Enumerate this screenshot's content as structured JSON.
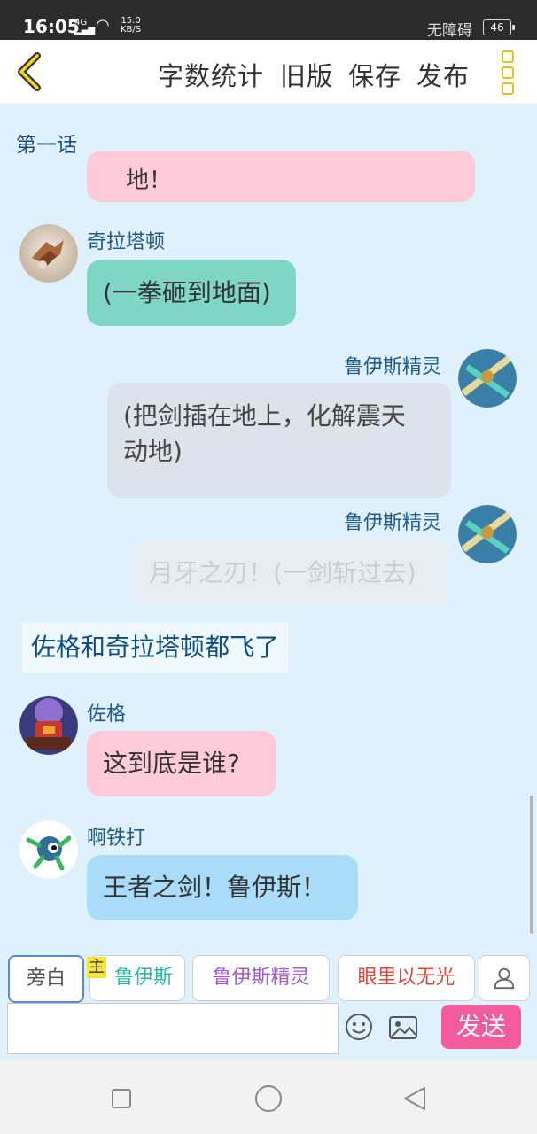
{
  "status_bar": {
    "time": "16:05",
    "net_label": "4G",
    "wifi_speed": "15.0",
    "speed_unit": "KB/S",
    "accessibility": "无障碍",
    "battery": "46"
  },
  "top_bar": {
    "menu": [
      "字数统计",
      "旧版",
      "保存",
      "发布"
    ]
  },
  "chapter_title": "第一话",
  "messages": [
    {
      "speaker": "",
      "text": "地！",
      "partial": true
    },
    {
      "speaker": "奇拉塔顿",
      "text": "(一拳砸到地面)"
    },
    {
      "speaker": "鲁伊斯精灵",
      "text": "(把剑插在地上，化解震天动地)",
      "lines": [
        "(把剑插在地上，化解震天",
        "动地)"
      ]
    },
    {
      "speaker": "鲁伊斯精灵",
      "text": "月牙之刃！(一剑斩过去)",
      "faded": true
    },
    {
      "narration": "佐格和奇拉塔顿都飞了"
    },
    {
      "speaker": "佐格",
      "text": "这到底是谁?"
    },
    {
      "speaker": "啊铁打",
      "text": "王者之剑！鲁伊斯！"
    }
  ],
  "roles": [
    {
      "label": "旁白",
      "color": "#555555"
    },
    {
      "label": "鲁伊斯",
      "color": "#2bb7a3",
      "tag": "主"
    },
    {
      "label": "鲁伊斯精灵",
      "color": "#a35cd0"
    },
    {
      "label": "眼里以无光",
      "color": "#e0443a"
    }
  ],
  "send_label": "发送",
  "colors": {
    "background": "#dff1fc",
    "pink": "#fdcad8",
    "teal": "#7fd6c5",
    "gray": "#dde3ea",
    "blue": "#a9dcf8",
    "send": "#f35c9c"
  }
}
